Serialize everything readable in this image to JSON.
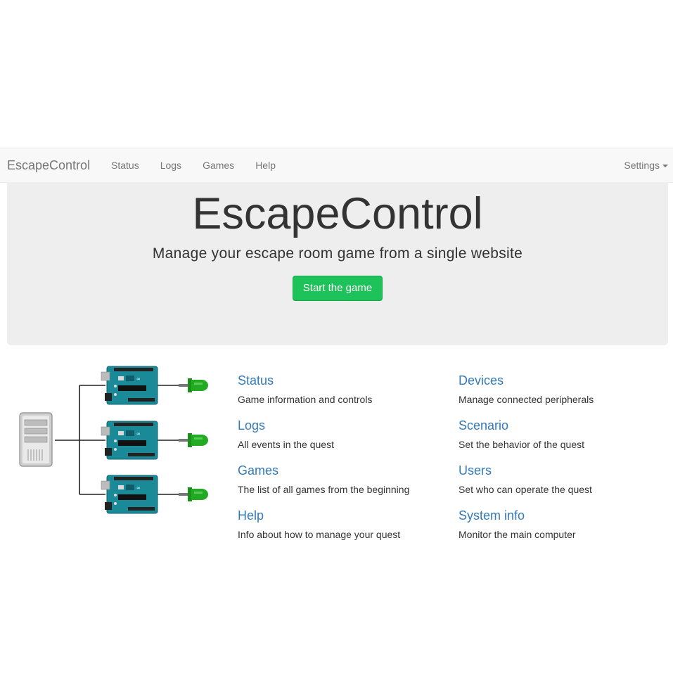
{
  "navbar": {
    "brand": "EscapeControl",
    "links": [
      "Status",
      "Logs",
      "Games",
      "Help"
    ],
    "settings_label": "Settings"
  },
  "jumbotron": {
    "title": "EscapeControl",
    "subtitle": "Manage your escape room game from a single website",
    "button_label": "Start the game",
    "button_color": "#1ec25a"
  },
  "sections": {
    "left": [
      {
        "title": "Status",
        "description": "Game information and controls"
      },
      {
        "title": "Logs",
        "description": "All events in the quest"
      },
      {
        "title": "Games",
        "description": "The list of all games from the beginning"
      },
      {
        "title": "Help",
        "description": "Info about how to manage your quest"
      }
    ],
    "right": [
      {
        "title": "Devices",
        "description": "Manage connected peripherals"
      },
      {
        "title": "Scenario",
        "description": "Set the behavior of the quest"
      },
      {
        "title": "Users",
        "description": "Set who can operate the quest"
      },
      {
        "title": "System info",
        "description": "Monitor the main computer"
      }
    ]
  },
  "colors": {
    "link": "#337ab7",
    "navbar_bg": "#f8f8f8",
    "jumbotron_bg": "#eeeeee",
    "arduino_board": "#1a8a99",
    "led_green": "#22aa22"
  }
}
